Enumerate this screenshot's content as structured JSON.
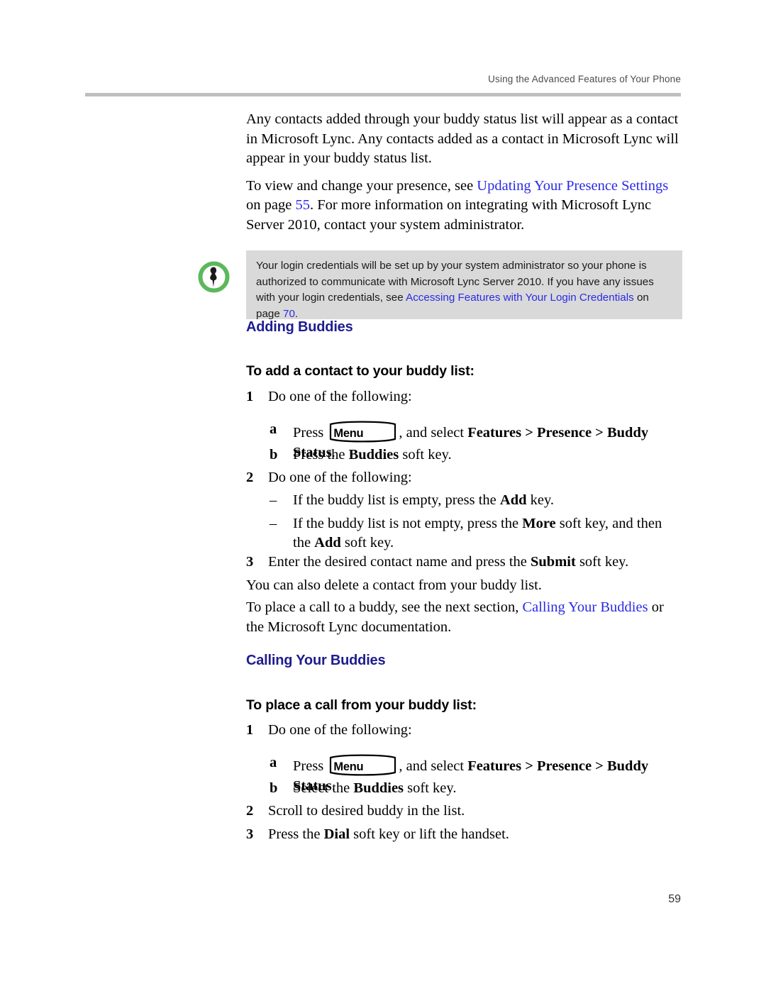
{
  "header": {
    "running_title": "Using the Advanced Features of Your Phone"
  },
  "intro": {
    "paragraph1": "Any contacts added through your buddy status list will appear as a contact in Microsoft Lync. Any contacts added as a contact in Microsoft Lync will appear in your buddy status list.",
    "paragraph2_before": "To view and change your presence, see ",
    "paragraph2_link": "Updating Your Presence Settings",
    "paragraph2_mid": " on page ",
    "paragraph2_pagelink": "55",
    "paragraph2_after": ". For more information on integrating with Microsoft Lync Server 2010, contact your system administrator."
  },
  "note": {
    "icon": "pushpin-icon",
    "icon_ring_color": "#5cb85c",
    "background_color": "#d9d9d9",
    "text_before": "Your login credentials will be set up by your system administrator so your phone is authorized to communicate with Microsoft Lync Server 2010. If you have any issues with your login credentials, see ",
    "link": "Accessing Features with Your Login Credentials",
    "text_mid": " on page ",
    "page_link": "70",
    "text_after": "."
  },
  "sections": [
    {
      "heading": "Adding Buddies",
      "subheading": "To add a contact to your buddy list:"
    },
    {
      "heading": "Calling Your Buddies",
      "subheading": "To place a call from your buddy list:"
    }
  ],
  "adding_steps": {
    "step1_num": "1",
    "step1_text": "Do one of the following:",
    "step1a_letter": "a",
    "step1a_before": "Press ",
    "step1a_key": "Menu",
    "step1a_after_plain": ", and select ",
    "step1a_after_bold": "Features > Presence > Buddy Status",
    "step1a_end": ".",
    "step1b_letter": "b",
    "step1b_before": "Press the ",
    "step1b_bold": "Buddies",
    "step1b_after": " soft key.",
    "step2_num": "2",
    "step2_text": "Do one of the following:",
    "dash1_before": "If the buddy list is empty, press the ",
    "dash1_bold": "Add",
    "dash1_after": " key.",
    "dash2_before": "If the buddy list is not empty, press the ",
    "dash2_bold1": "More",
    "dash2_mid": " soft key, and then the ",
    "dash2_bold2": "Add",
    "dash2_after": " soft key.",
    "step3_num": "3",
    "step3_before": "Enter the desired contact name and press the ",
    "step3_bold": "Submit",
    "step3_after": " soft key."
  },
  "adding_outro": {
    "paragraph1": "You can also delete a contact from your buddy list.",
    "paragraph2_before": "To place a call to a buddy, see the next section, ",
    "paragraph2_link": "Calling Your Buddies",
    "paragraph2_after": " or the Microsoft Lync documentation."
  },
  "calling_steps": {
    "step1_num": "1",
    "step1_text": "Do one of the following:",
    "step1a_letter": "a",
    "step1a_before": "Press ",
    "step1a_key": "Menu",
    "step1a_after_plain": ", and select ",
    "step1a_after_bold": "Features > Presence > Buddy Status",
    "step1a_end": ".",
    "step1b_letter": "b",
    "step1b_before": "Select the ",
    "step1b_bold": "Buddies",
    "step1b_after": " soft key.",
    "step2_num": "2",
    "step2_text": "Scroll to desired buddy in the list.",
    "step3_num": "3",
    "step3_before": "Press the ",
    "step3_bold": "Dial",
    "step3_after": " soft key or lift the handset."
  },
  "footer": {
    "page_number": "59"
  }
}
